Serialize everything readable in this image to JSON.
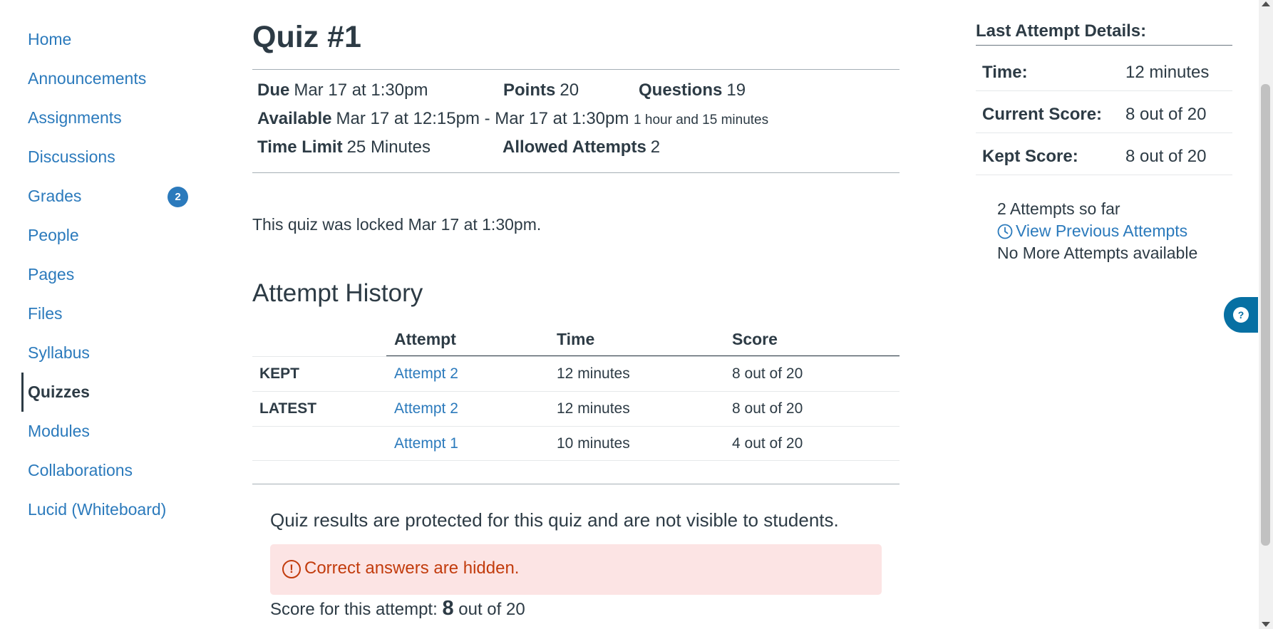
{
  "nav": {
    "items": [
      {
        "label": "Home"
      },
      {
        "label": "Announcements"
      },
      {
        "label": "Assignments"
      },
      {
        "label": "Discussions"
      },
      {
        "label": "Grades",
        "badge": "2"
      },
      {
        "label": "People"
      },
      {
        "label": "Pages"
      },
      {
        "label": "Files"
      },
      {
        "label": "Syllabus"
      },
      {
        "label": "Quizzes",
        "active": true
      },
      {
        "label": "Modules"
      },
      {
        "label": "Collaborations"
      },
      {
        "label": "Lucid (Whiteboard)"
      }
    ]
  },
  "quiz": {
    "title": "Quiz #1",
    "due_label": "Due",
    "due_value": "Mar 17 at 1:30pm",
    "points_label": "Points",
    "points_value": "20",
    "questions_label": "Questions",
    "questions_value": "19",
    "available_label": "Available",
    "available_value": "Mar 17 at 12:15pm - Mar 17 at 1:30pm",
    "available_duration": "1 hour and 15 minutes",
    "time_limit_label": "Time Limit",
    "time_limit_value": "25 Minutes",
    "allowed_attempts_label": "Allowed Attempts",
    "allowed_attempts_value": "2",
    "lock_message": "This quiz was locked Mar 17 at 1:30pm."
  },
  "history": {
    "title": "Attempt History",
    "columns": [
      "Attempt",
      "Time",
      "Score"
    ],
    "rows": [
      {
        "tag": "KEPT",
        "attempt": "Attempt 2",
        "time": "12 minutes",
        "score": "8 out of 20"
      },
      {
        "tag": "LATEST",
        "attempt": "Attempt 2",
        "time": "12 minutes",
        "score": "8 out of 20"
      },
      {
        "tag": "",
        "attempt": "Attempt 1",
        "time": "10 minutes",
        "score": "4 out of 20"
      }
    ]
  },
  "results": {
    "protected_message": "Quiz results are protected for this quiz and are not visible to students.",
    "hidden_icon": "exclamation-circle-icon",
    "hidden_message": "Correct answers are hidden.",
    "score_prefix": "Score for this attempt:",
    "score_value": "8",
    "score_suffix": "out of 20"
  },
  "sidebar": {
    "title": "Last Attempt Details:",
    "details": [
      {
        "label": "Time:",
        "value": "12 minutes"
      },
      {
        "label": "Current Score:",
        "value": "8 out of 20"
      },
      {
        "label": "Kept Score:",
        "value": "8 out of 20"
      }
    ],
    "attempts_so_far": "2 Attempts so far",
    "view_previous": "View Previous Attempts",
    "no_more": "No More Attempts available"
  },
  "colors": {
    "link": "#2b7abc",
    "text": "#2d3b45",
    "alert_bg": "#fce4e4",
    "alert_text": "#c23c0d",
    "help_tab": "#0770a3"
  }
}
